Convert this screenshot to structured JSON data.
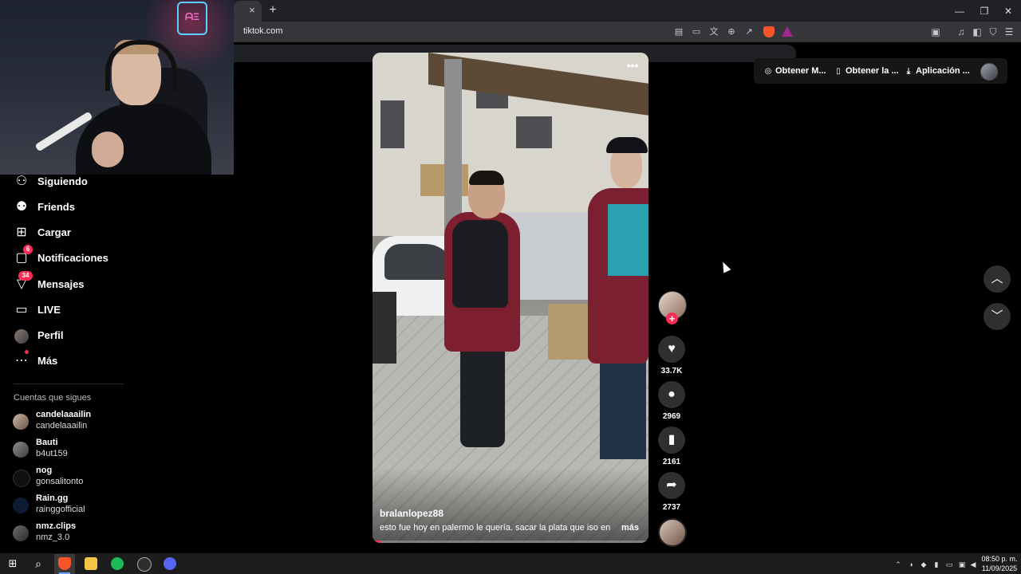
{
  "browser": {
    "url": "tiktok.com",
    "tab_close": "×",
    "new_tab": "+",
    "window_controls": {
      "minimize": "—",
      "restore": "❐",
      "close": "✕"
    }
  },
  "webcam": {
    "neon_sign": "ᗩΞ"
  },
  "sidebar": {
    "items": [
      {
        "label": "Siguiendo",
        "icon": "user-follow-icon"
      },
      {
        "label": "Friends",
        "icon": "friends-icon"
      },
      {
        "label": "Cargar",
        "icon": "upload-plus-icon"
      },
      {
        "label": "Notificaciones",
        "icon": "notification-icon",
        "badge": "6"
      },
      {
        "label": "Mensajes",
        "icon": "messages-icon",
        "badge": "34"
      },
      {
        "label": "LIVE",
        "icon": "live-tv-icon"
      },
      {
        "label": "Perfil",
        "icon": "profile-avatar"
      },
      {
        "label": "Más",
        "icon": "more-icon"
      }
    ],
    "following_title": "Cuentas que sigues",
    "following": [
      {
        "name": "candelaaailin",
        "handle": "candelaaailin"
      },
      {
        "name": "Bauti",
        "handle": "b4ut159"
      },
      {
        "name": "nog",
        "handle": "gonsalitonto"
      },
      {
        "name": "Rain.gg",
        "handle": "rainggofficial"
      },
      {
        "name": "nmz.clips",
        "handle": "nmz_3.0"
      }
    ]
  },
  "video": {
    "author": "bralanlopez88",
    "caption": "esto fue hoy en palermo le quería. sacar la plata que iso en ...",
    "more_label": "más",
    "menu_glyph": "•••",
    "progress": 0.03
  },
  "actions": {
    "follow_glyph": "+",
    "likes": "33.7K",
    "comments": "2969",
    "saves": "2161",
    "shares": "2737"
  },
  "top_actions": {
    "coins": "Obtener M...",
    "app": "Obtener la ...",
    "desktop_app": "Aplicación ..."
  },
  "taskbar": {
    "time": "08:50 p. m.",
    "date": "11/09/2025"
  },
  "colors": {
    "accent": "#fe2c55",
    "background": "#000000",
    "button_bg": "#2f2f2f"
  }
}
